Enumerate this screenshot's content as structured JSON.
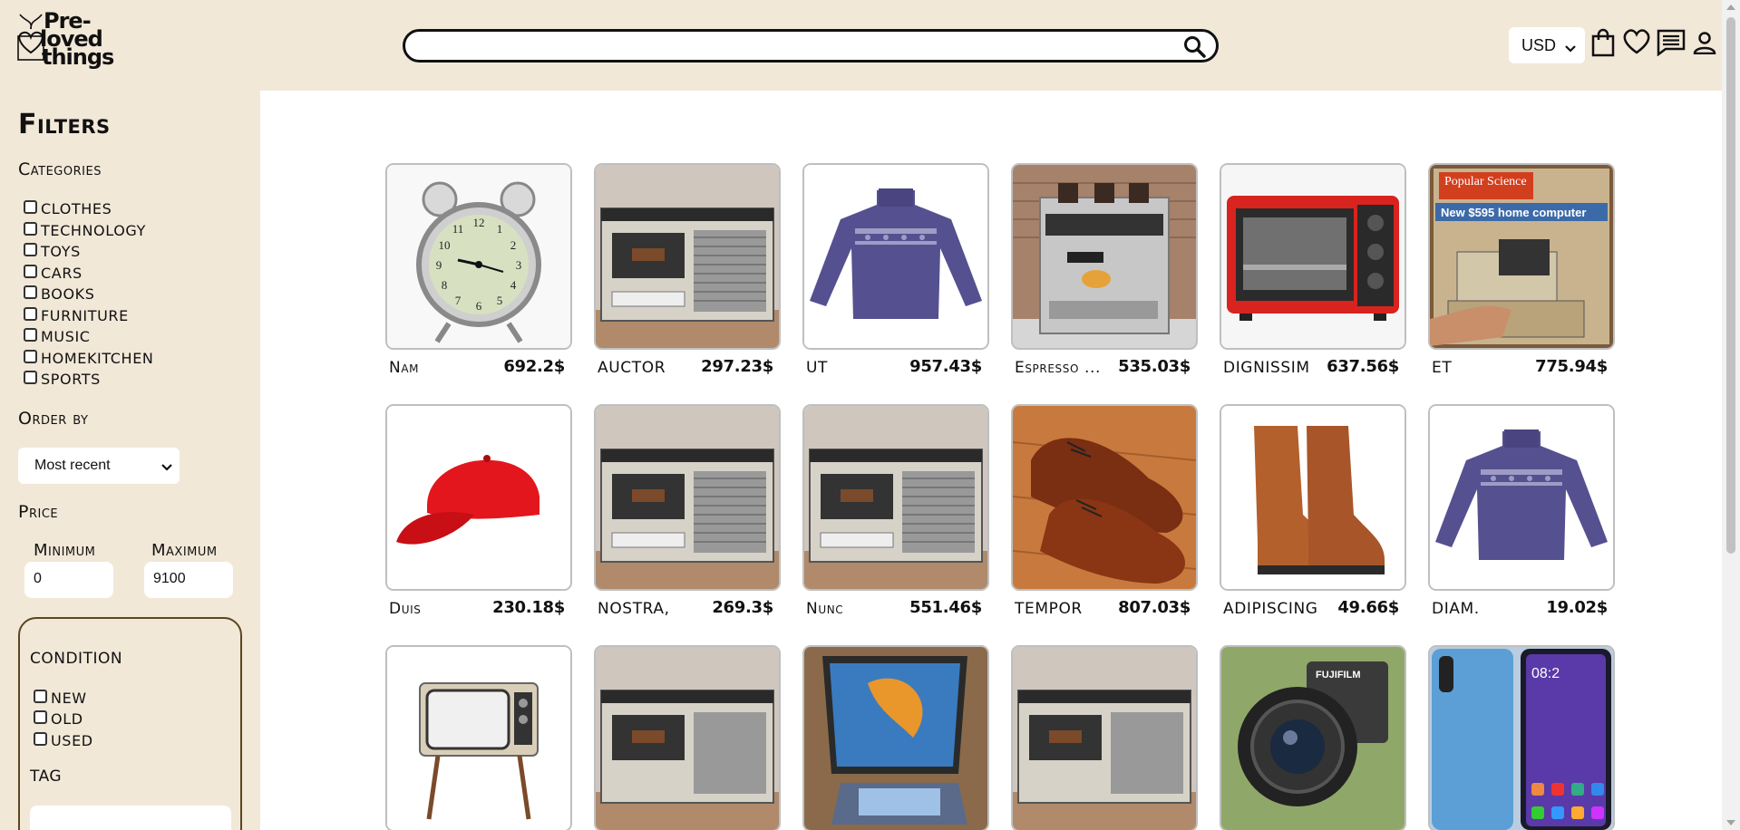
{
  "header": {
    "logo": {
      "line1": "Pre-",
      "line2": "loved",
      "line3": "things"
    },
    "search": {
      "value": "",
      "placeholder": ""
    },
    "currency": {
      "selected": "USD"
    },
    "icons": [
      "search-icon",
      "shopping-bag-icon",
      "heart-icon",
      "chat-icon",
      "user-icon"
    ]
  },
  "sidebar": {
    "title": "Filters",
    "categories_label": "Categories",
    "categories": [
      "CLOTHES",
      "TECHNOLOGY",
      "TOYS",
      "CARS",
      "BOOKS",
      "FURNITURE",
      "MUSIC",
      "HOMEKITCHEN",
      "SPORTS"
    ],
    "order_by_label": "Order by",
    "order_by_selected": "Most recent",
    "price_label": "Price",
    "price_min_label": "Minimum",
    "price_max_label": "Maximum",
    "price_min_value": "0",
    "price_max_value": "9100",
    "condition_label": "CONDITION",
    "conditions": [
      "NEW",
      "OLD",
      "USED"
    ],
    "tag_label": "TAG",
    "tag_value": ""
  },
  "products": [
    {
      "name": "Nam",
      "price": "692.2$",
      "image": "alarm-clock"
    },
    {
      "name": "AUCTOR",
      "price": "297.23$",
      "image": "cassette-radio"
    },
    {
      "name": "UT",
      "price": "957.43$",
      "image": "purple-sweater"
    },
    {
      "name": "Espresso ...",
      "price": "535.03$",
      "image": "espresso-machine"
    },
    {
      "name": "DIGNISSIM",
      "price": "637.56$",
      "image": "toaster-oven"
    },
    {
      "name": "ET",
      "price": "775.94$",
      "image": "magazine"
    },
    {
      "name": "Duis",
      "price": "230.18$",
      "image": "red-cap"
    },
    {
      "name": "NOSTRA,",
      "price": "269.3$",
      "image": "cassette-radio"
    },
    {
      "name": "Nunc",
      "price": "551.46$",
      "image": "cassette-radio"
    },
    {
      "name": "TEMPOR",
      "price": "807.03$",
      "image": "leather-shoes"
    },
    {
      "name": "ADIPISCING",
      "price": "49.66$",
      "image": "leather-boots"
    },
    {
      "name": "DIAM.",
      "price": "19.02$",
      "image": "purple-sweater"
    },
    {
      "name": "",
      "price": "",
      "image": "retro-tv"
    },
    {
      "name": "",
      "price": "",
      "image": "cassette-radio"
    },
    {
      "name": "",
      "price": "",
      "image": "tablet"
    },
    {
      "name": "",
      "price": "",
      "image": "cassette-radio"
    },
    {
      "name": "",
      "price": "",
      "image": "camera"
    },
    {
      "name": "",
      "price": "",
      "image": "smartphone"
    }
  ],
  "product_images": {
    "magazine_text": "Popular Science",
    "magazine_headline": "New $595 home computer",
    "camera_brand": "FUJIFILM",
    "phone_time": "08:2"
  },
  "colors": {
    "background": "#f2e8d8",
    "content": "#ffffff",
    "condition_border": "#5b4620"
  }
}
